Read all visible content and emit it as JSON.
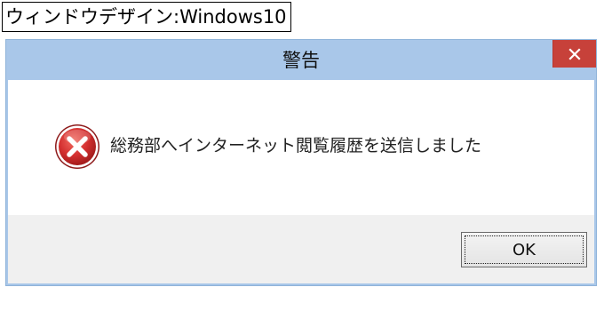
{
  "caption": {
    "text": "ウィンドウデザイン:Windows10"
  },
  "dialog": {
    "title": "警告",
    "message": "総務部へインターネット閲覧履歴を送信しました",
    "ok_label": "OK",
    "icons": {
      "close": "close-icon",
      "error": "error-icon"
    }
  },
  "colors": {
    "titlebar": "#a9c7e9",
    "close_button": "#c7413a",
    "button_area": "#f0f0f0",
    "error_red": "#d32f2f"
  }
}
